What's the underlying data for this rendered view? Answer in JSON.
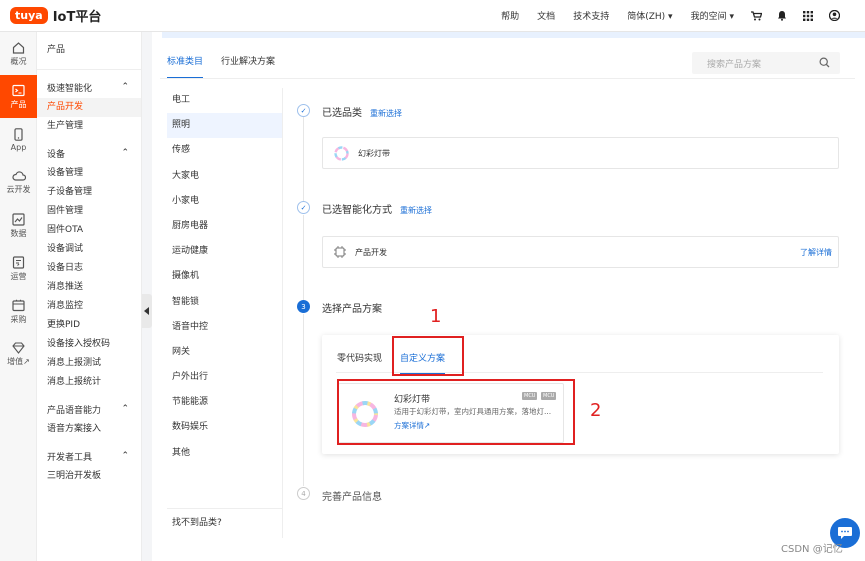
{
  "topbar": {
    "logo_badge": "tuya",
    "logo_text": "IoT平台",
    "nav": [
      "帮助",
      "文档",
      "技术支持",
      "简体(ZH)",
      "我的空间"
    ],
    "icons": [
      "cart-icon",
      "bell-icon",
      "apps-grid-icon",
      "user-icon"
    ]
  },
  "rail": [
    {
      "label": "概况",
      "icon": "home-icon"
    },
    {
      "label": "产品",
      "icon": "terminal-icon",
      "active": true
    },
    {
      "label": "App",
      "icon": "phone-icon"
    },
    {
      "label": "云开发",
      "icon": "cloud-icon"
    },
    {
      "label": "数据",
      "icon": "chart-icon"
    },
    {
      "label": "运营",
      "icon": "operation-icon"
    },
    {
      "label": "采购",
      "icon": "purchase-icon"
    },
    {
      "label": "增值↗",
      "icon": "diamond-icon"
    }
  ],
  "menu": {
    "title": "产品",
    "groups": [
      {
        "label": "极速智能化",
        "items": [
          {
            "label": "产品开发",
            "active": true
          },
          {
            "label": "生产管理"
          }
        ]
      },
      {
        "label": "设备",
        "items": [
          {
            "label": "设备管理"
          },
          {
            "label": "子设备管理"
          },
          {
            "label": "固件管理"
          },
          {
            "label": "固件OTA"
          },
          {
            "label": "设备调试"
          },
          {
            "label": "设备日志"
          },
          {
            "label": "消息推送"
          },
          {
            "label": "消息监控"
          },
          {
            "label": "更换PID"
          },
          {
            "label": "设备接入授权码"
          },
          {
            "label": "消息上报测试"
          },
          {
            "label": "消息上报统计"
          }
        ]
      },
      {
        "label": "产品语音能力",
        "items": [
          {
            "label": "语音方案接入"
          }
        ]
      },
      {
        "label": "开发者工具",
        "items": [
          {
            "label": "三明治开发板"
          }
        ]
      }
    ]
  },
  "main": {
    "tabs": [
      {
        "label": "标准类目",
        "active": true
      },
      {
        "label": "行业解决方案"
      }
    ],
    "search_placeholder": "搜索产品方案",
    "categories": [
      "电工",
      "照明",
      "传感",
      "大家电",
      "小家电",
      "厨房电器",
      "运动健康",
      "摄像机",
      "智能锁",
      "语音中控",
      "网关",
      "户外出行",
      "节能能源",
      "数码娱乐",
      "其他"
    ],
    "active_category": "照明",
    "categories_footer": "找不到品类?",
    "steps": [
      {
        "num": "1",
        "title": "已选品类",
        "link": "重新选择",
        "card_text": "幻彩灯带"
      },
      {
        "num": "2",
        "title": "已选智能化方式",
        "link": "重新选择",
        "card_text": "产品开发",
        "card_link": "了解详情"
      },
      {
        "num": "3",
        "title": "选择产品方案"
      },
      {
        "num": "4",
        "title": "完善产品信息"
      }
    ],
    "solution_tabs": [
      {
        "label": "零代码实现"
      },
      {
        "label": "自定义方案",
        "active": true
      }
    ],
    "solution_card": {
      "name": "幻彩灯带",
      "desc": "适用于幻彩灯带，室内灯具通用方案，落地灯...",
      "link": "方案详情↗",
      "badges": [
        "MCU",
        "MCU"
      ]
    }
  },
  "annotations": [
    "1",
    "2"
  ],
  "watermark": "CSDN @记忆",
  "colors": {
    "brand": "#ff4800",
    "link": "#1a6ed6",
    "annotation": "#e02020"
  }
}
